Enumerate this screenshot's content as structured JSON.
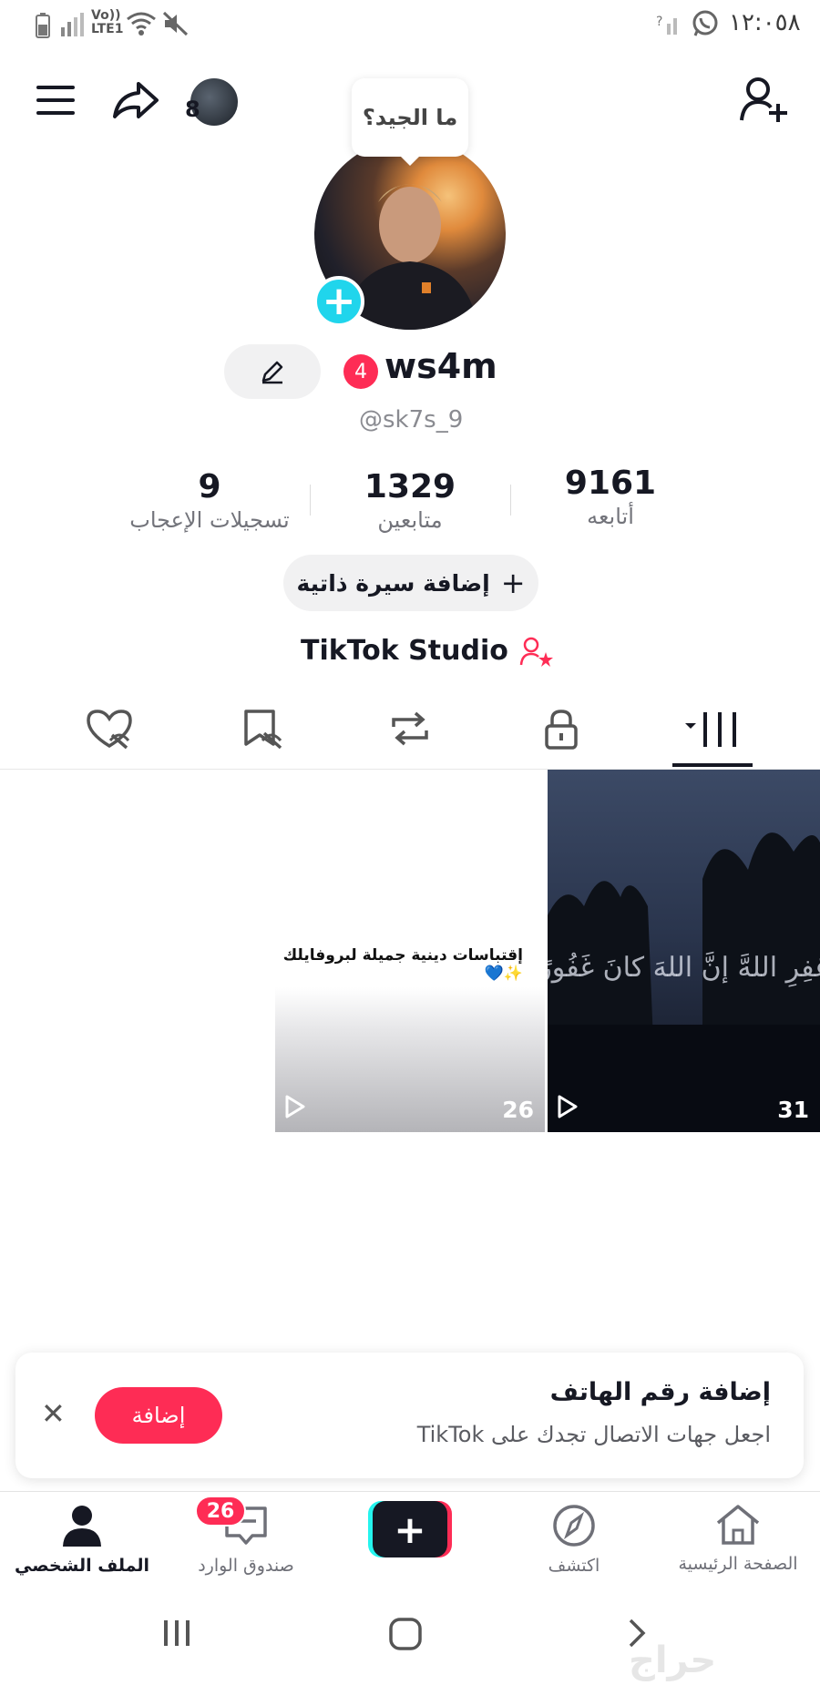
{
  "status_bar": {
    "time": "١٢:٠٥٨",
    "network_label": "LTE1",
    "volte_label": "Vo))"
  },
  "top_bar": {
    "friends_count": "8"
  },
  "tooltip": {
    "text": "ما الجيد؟"
  },
  "profile": {
    "badge_count": "4",
    "username": "ws4m",
    "handle": "@sk7s_9"
  },
  "stats": {
    "following": {
      "value": "9161",
      "label": "أتابعه"
    },
    "followers": {
      "value": "1329",
      "label": "متابعين"
    },
    "likes": {
      "value": "9",
      "label": "تسجيلات الإعجاب"
    }
  },
  "bio_button": {
    "label": "إضافة سيرة ذاتية"
  },
  "studio": {
    "label": "TikTok Studio"
  },
  "tabs": [
    "videos-grid-icon",
    "lock-icon",
    "repost-icon",
    "favorites-icon",
    "liked-icon"
  ],
  "videos": [
    {
      "caption": "إقتباسات دينية جميلة لبروفايلك",
      "views": "26"
    },
    {
      "caption": "غفِرِ اللهَّ إنَّ اللهَ كانَ غَفُورًا رَحِيمًا",
      "views": "31"
    }
  ],
  "toast": {
    "title": "إضافة رقم الهاتف",
    "subtitle": "اجعل جهات الاتصال تجدك على TikTok",
    "add_label": "إضافة"
  },
  "bottom_nav": {
    "home": "الصفحة الرئيسية",
    "discover": "اكتشف",
    "inbox": "صندوق الوارد",
    "inbox_badge": "26",
    "profile": "الملف الشخصي"
  },
  "watermark": "حراج",
  "colors": {
    "accent": "#fe2c55",
    "cyan": "#20d5ec",
    "text": "#161823"
  }
}
